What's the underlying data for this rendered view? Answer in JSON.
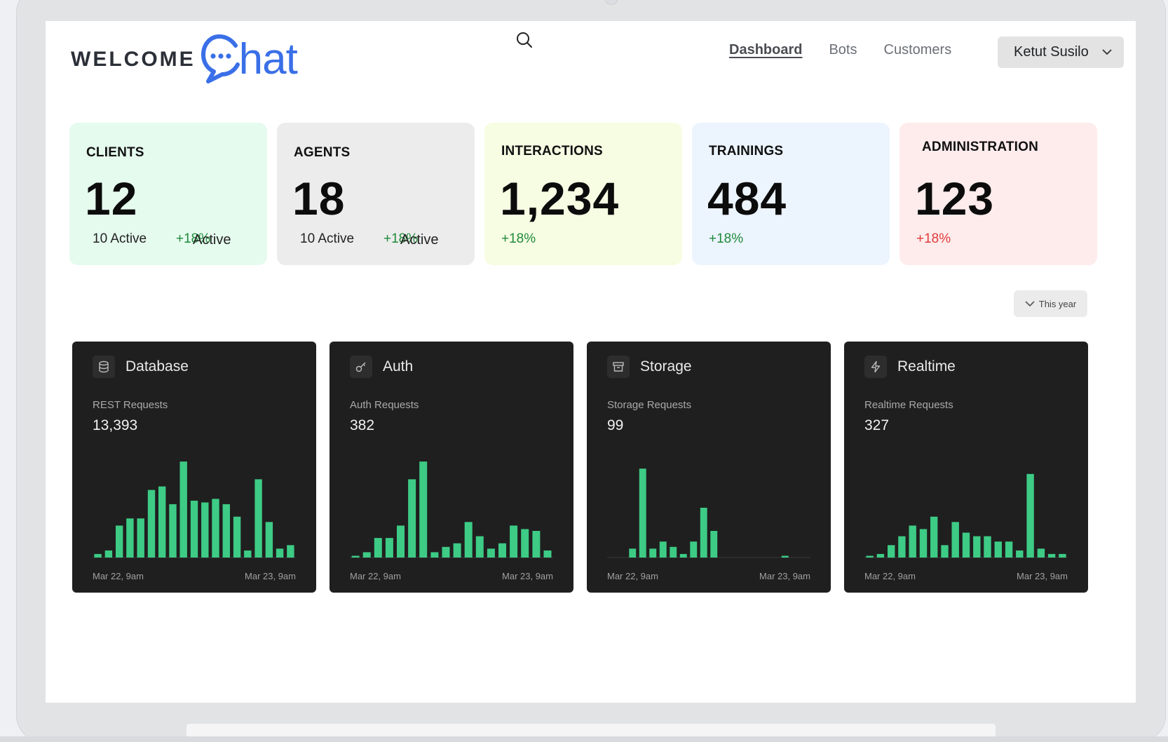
{
  "brand": {
    "welcome": "WELCOME",
    "chat_rest": "hat",
    "accent": "#3a6fe8"
  },
  "nav": {
    "items": [
      "Dashboard",
      "Bots",
      "Customers"
    ],
    "active": "Dashboard"
  },
  "user": {
    "name": "Ketut Susilo"
  },
  "stats": [
    {
      "title": "CLIENTS",
      "value": "12",
      "active": "10 Active",
      "pct": "+18%",
      "active2": "Active",
      "bg": "#e5fbee"
    },
    {
      "title": "AGENTS",
      "value": "18",
      "active": "10 Active",
      "pct": "+18%",
      "active2": "Active",
      "bg": "#ececec"
    },
    {
      "title": "INTERACTIONS",
      "value": "1,234",
      "pct": "+18%",
      "bg": "#f7fde3"
    },
    {
      "title": "TRAININGS",
      "value": "484",
      "pct": "+18%",
      "bg": "#ecf4fe"
    },
    {
      "title": "ADMINISTRATION",
      "value": "123",
      "pct": "+18%",
      "bg": "#feecec"
    }
  ],
  "filter": {
    "label": "This year"
  },
  "chart_data": [
    {
      "type": "bar",
      "name": "Database",
      "icon": "database-icon",
      "metric_label": "REST Requests",
      "metric_value": "13,393",
      "x_start": "Mar 22, 9am",
      "x_end": "Mar 23, 9am",
      "values": [
        2,
        4,
        18,
        22,
        22,
        38,
        40,
        30,
        54,
        32,
        31,
        33,
        30,
        23,
        4,
        44,
        20,
        5,
        7
      ]
    },
    {
      "type": "bar",
      "name": "Auth",
      "icon": "key-icon",
      "metric_label": "Auth Requests",
      "metric_value": "382",
      "x_start": "Mar 22, 9am",
      "x_end": "Mar 23, 9am",
      "values": [
        1,
        3,
        11,
        11,
        18,
        44,
        54,
        3,
        6,
        8,
        20,
        12,
        5,
        8,
        18,
        16,
        15,
        4
      ]
    },
    {
      "type": "bar",
      "name": "Storage",
      "icon": "archive-icon",
      "metric_label": "Storage Requests",
      "metric_value": "99",
      "x_start": "Mar 22, 9am",
      "x_end": "Mar 23, 9am",
      "values": [
        0,
        0,
        5,
        50,
        5,
        9,
        6,
        2,
        9,
        28,
        15,
        0,
        0,
        0,
        0,
        0,
        0,
        1,
        0,
        0
      ]
    },
    {
      "type": "bar",
      "name": "Realtime",
      "icon": "lightning-icon",
      "metric_label": "Realtime Requests",
      "metric_value": "327",
      "x_start": "Mar 22, 9am",
      "x_end": "Mar 23, 9am",
      "values": [
        1,
        2,
        7,
        12,
        18,
        16,
        23,
        7,
        20,
        14,
        12,
        12,
        9,
        9,
        4,
        47,
        5,
        2,
        2
      ]
    }
  ],
  "bar_color": "#3dcb85"
}
